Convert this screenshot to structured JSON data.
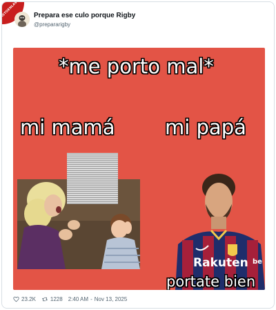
{
  "watermark": {
    "text": "VISTOENLASREDES.COM"
  },
  "post": {
    "display_name": "Prepara ese culo porque Rigby",
    "handle": "@prepararigby"
  },
  "meme": {
    "title": "*me porto mal*",
    "left_label": "mi mamá",
    "right_label": "mi papá",
    "caption": "portate bien",
    "shirt_sponsor": "Rakuten",
    "colors": {
      "background": "#e35446"
    }
  },
  "footer": {
    "likes": "23.2K",
    "retweets": "1228",
    "time": "2:40 AM",
    "date": "Nov 13, 2025",
    "separator": "-",
    "icons": {
      "like": "heart-icon",
      "retweet": "retweet-icon"
    }
  }
}
